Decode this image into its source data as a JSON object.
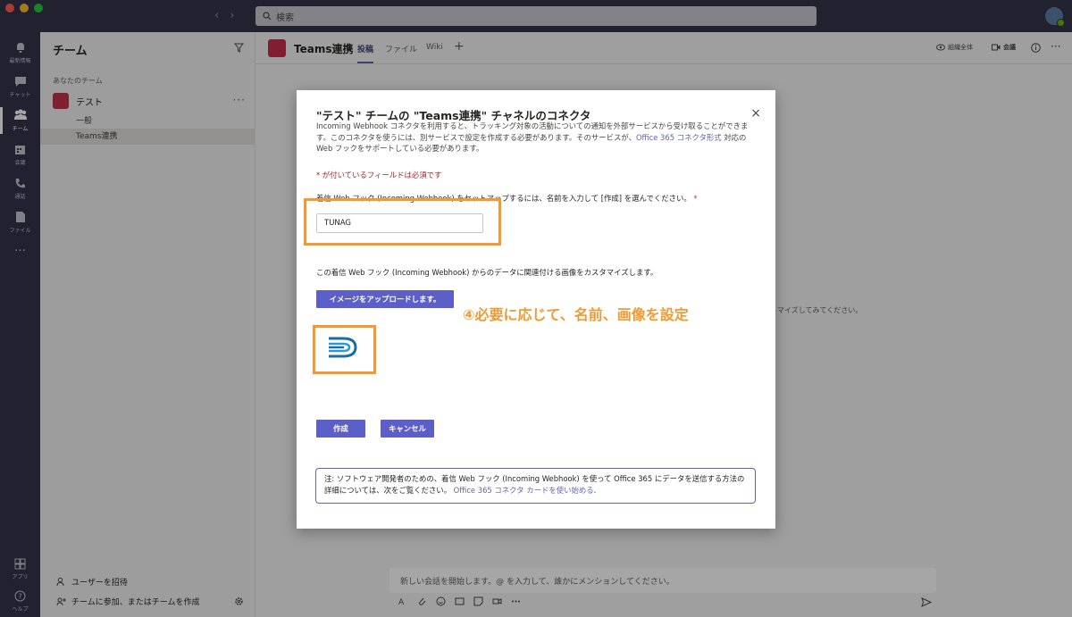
{
  "search": {
    "placeholder": "検索"
  },
  "rail": {
    "items": [
      {
        "label": "最新情報",
        "icon": "bell-icon"
      },
      {
        "label": "チャット",
        "icon": "chat-icon"
      },
      {
        "label": "チーム",
        "icon": "teams-icon",
        "active": true
      },
      {
        "label": "会議",
        "icon": "calendar-icon"
      },
      {
        "label": "通話",
        "icon": "phone-icon"
      },
      {
        "label": "ファイル",
        "icon": "file-icon"
      }
    ],
    "more": "…",
    "apps": "アプリ",
    "help": "ヘルプ"
  },
  "team_panel": {
    "title": "チーム",
    "section": "あなたのチーム",
    "team_name": "テスト",
    "channels": [
      "一般",
      "Teams連携"
    ],
    "invite": "ユーザーを招待",
    "join": "チームに参加、またはチームを作成"
  },
  "channel_header": {
    "name": "Teams連携",
    "tabs": [
      "投稿",
      "ファイル",
      "Wiki"
    ],
    "add_tab": "+",
    "org": "組織全体",
    "meet": "会議"
  },
  "main": {
    "hint_tail": "マイズしてみてください。",
    "composer_placeholder": "新しい会話を開始します。@ を入力して、誰かにメンションしてください。"
  },
  "modal": {
    "title": "\"テスト\" チームの \"Teams連携\" チャネルのコネクタ",
    "close": "×",
    "desc_text": "Incoming Webhook コネクタを利用すると、トラッキング対象の活動についての通知を外部サービスから受け取ることができます。このコネクタを使うには、別サービスで設定を作成する必要があります。そのサービスが、",
    "desc_link": "Office 365 コネクタ形式",
    "desc_tail": " 対応の Web フックをサポートしている必要があります。",
    "required_note": "* が付いているフィールドは必須です",
    "name_label": "着信 Web フック (Incoming Webhook) をセットアップするには、名前を入力して [作成] を選んでください。",
    "name_star": "*",
    "name_value": "TUNAG",
    "image_label": "この着信 Web フック (Incoming Webhook) からのデータに関連付ける画像をカスタマイズします。",
    "upload_button": "イメージをアップロードします。",
    "create_button": "作成",
    "cancel_button": "キャンセル",
    "note_text": "注: ソフトウェア開発者のための、着信 Web フック (Incoming Webhook) を使って Office 365 にデータを送信する方法の詳細については、次をご覧ください。",
    "note_link": "Office 365 コネクタ カードを使い始める",
    "note_end": "."
  },
  "annotation": "④必要に応じて、名前、画像を設定",
  "colors": {
    "accent": "#6264a7",
    "annotation": "#f09a33",
    "rail": "#33344a",
    "required": "#a4262c"
  }
}
